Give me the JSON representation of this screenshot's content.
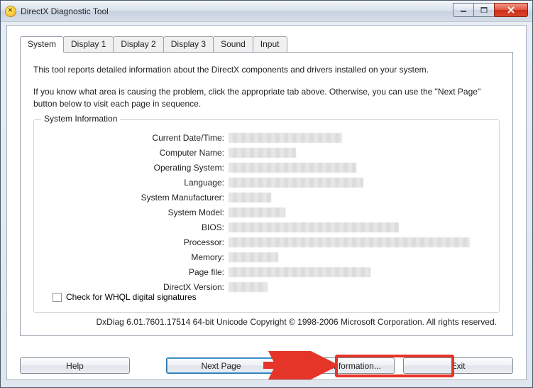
{
  "window": {
    "title": "DirectX Diagnostic Tool"
  },
  "tabs": [
    {
      "label": "System",
      "active": true
    },
    {
      "label": "Display 1",
      "active": false
    },
    {
      "label": "Display 2",
      "active": false
    },
    {
      "label": "Display 3",
      "active": false
    },
    {
      "label": "Sound",
      "active": false
    },
    {
      "label": "Input",
      "active": false
    }
  ],
  "intro": {
    "line1": "This tool reports detailed information about the DirectX components and drivers installed on your system.",
    "line2": "If you know what area is causing the problem, click the appropriate tab above.  Otherwise, you can use the \"Next Page\" button below to visit each page in sequence."
  },
  "sysinfo": {
    "legend": "System Information",
    "rows": [
      {
        "label": "Current Date/Time:",
        "value": "",
        "redact_w": 160
      },
      {
        "label": "Computer Name:",
        "value": "",
        "redact_w": 95
      },
      {
        "label": "Operating System:",
        "value": "",
        "redact_w": 180
      },
      {
        "label": "Language:",
        "value": "",
        "redact_w": 190
      },
      {
        "label": "System Manufacturer:",
        "value": "",
        "redact_w": 60
      },
      {
        "label": "System Model:",
        "value": "",
        "redact_w": 80
      },
      {
        "label": "BIOS:",
        "value": "",
        "redact_w": 240
      },
      {
        "label": "Processor:",
        "value": "",
        "redact_w": 340
      },
      {
        "label": "Memory:",
        "value": "",
        "redact_w": 70
      },
      {
        "label": "Page file:",
        "value": "",
        "redact_w": 200
      },
      {
        "label": "DirectX Version:",
        "value": "",
        "redact_w": 55
      }
    ],
    "checkbox_label": "Check for WHQL digital signatures"
  },
  "copyright": "DxDiag 6.01.7601.17514 64-bit Unicode  Copyright © 1998-2006 Microsoft Corporation.  All rights reserved.",
  "buttons": {
    "help": "Help",
    "nextpage": "Next Page",
    "saveall": "Save All Information...",
    "exit": "Exit"
  },
  "overlay": {
    "arrow_color": "#e53528"
  }
}
